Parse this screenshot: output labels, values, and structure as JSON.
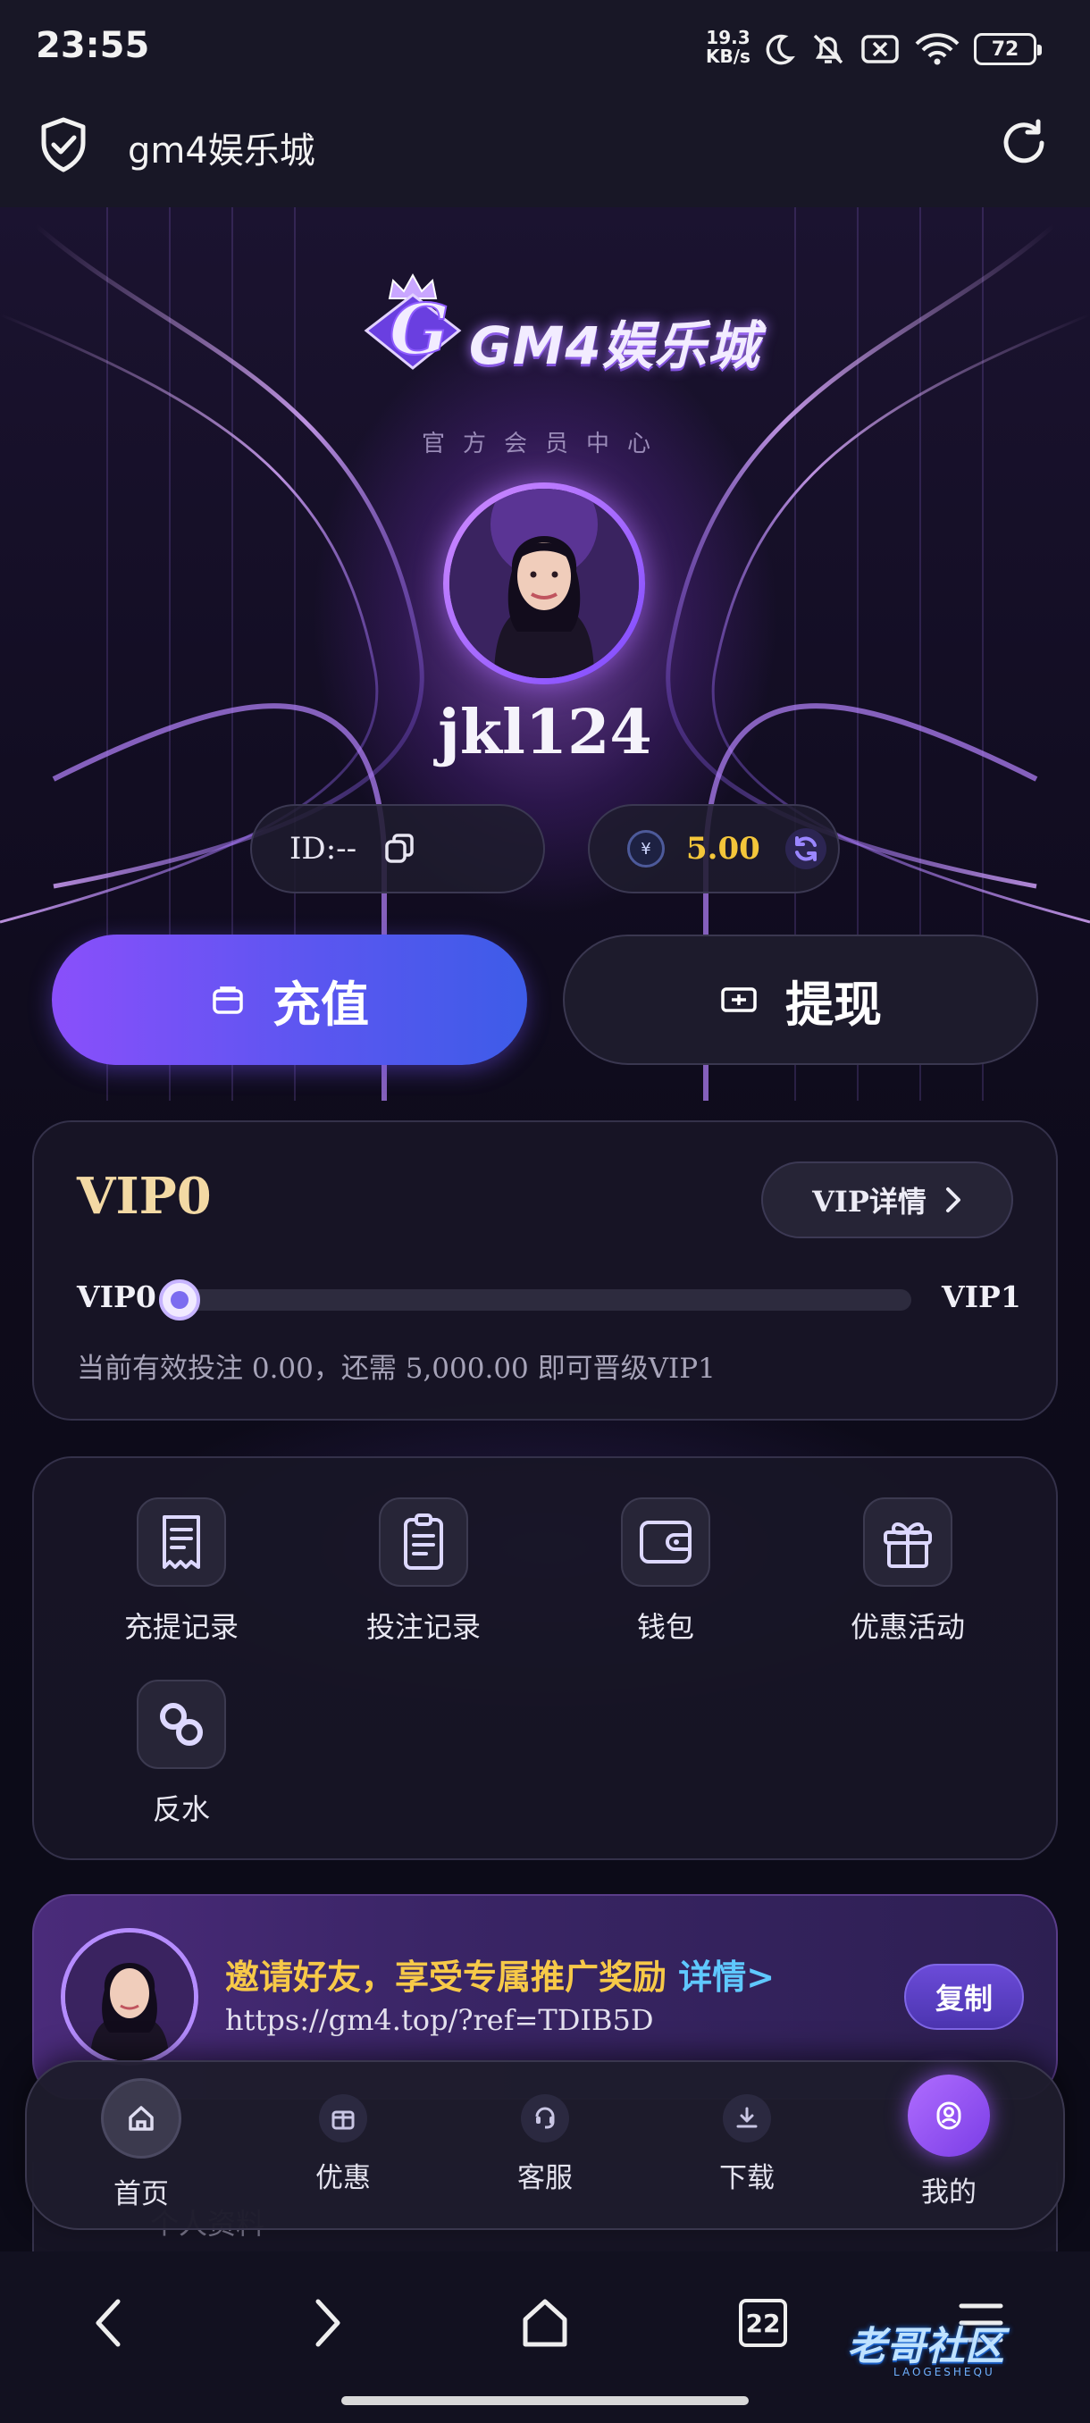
{
  "status_bar": {
    "time": "23:55",
    "net_speed_value": "19.3",
    "net_speed_unit": "KB/s",
    "battery": "72",
    "icons": [
      "moon-icon",
      "bell-off-icon",
      "sim-off-icon",
      "wifi-icon"
    ]
  },
  "app_bar": {
    "title": "gm4娱乐城",
    "shield_icon": "shield-check-icon",
    "refresh_icon": "refresh-icon"
  },
  "hero": {
    "logo_text": "GM4娱乐城",
    "subtitle": "官方会员中心",
    "username": "jkl124",
    "id_label": "ID:--",
    "balance": "5.00",
    "coin_symbol": "¥"
  },
  "actions": {
    "recharge": "充值",
    "withdraw": "提现"
  },
  "vip": {
    "level": "VIP0",
    "details_label": "VIP详情",
    "from": "VIP0",
    "to": "VIP1",
    "progress": 0,
    "note": "当前有效投注 0.00，还需 5,000.00 即可晋级VIP1"
  },
  "menu": {
    "items": [
      {
        "label": "充提记录",
        "icon": "receipt-icon"
      },
      {
        "label": "投注记录",
        "icon": "clipboard-icon"
      },
      {
        "label": "钱包",
        "icon": "wallet-icon"
      },
      {
        "label": "优惠活动",
        "icon": "gift-icon"
      },
      {
        "label": "反水",
        "icon": "link-icon"
      }
    ]
  },
  "invite": {
    "title": "邀请好友，享受专属推广奖励",
    "more": "详情>",
    "link": "https://gm4.top/?ref=TDIB5D",
    "copy_label": "复制"
  },
  "partial_row": {
    "label": "个人资料"
  },
  "tab_bar": {
    "tabs": [
      {
        "label": "首页",
        "icon": "home-icon"
      },
      {
        "label": "优惠",
        "icon": "gift-box-icon"
      },
      {
        "label": "客服",
        "icon": "support-icon"
      },
      {
        "label": "下载",
        "icon": "download-icon"
      },
      {
        "label": "我的",
        "icon": "user-icon"
      }
    ],
    "active": "我的"
  },
  "system_nav": {
    "tab_count": "22",
    "watermark": "老哥社区",
    "watermark_sub": "LAOGESHEQU"
  },
  "colors": {
    "accent_purple": "#8a4ffb",
    "accent_blue": "#3d5ce8",
    "balance_gold": "#f4c63a",
    "vip_gold": "#f3d9a4",
    "invite_yellow": "#f7c948",
    "link_blue": "#5fc8ff"
  }
}
